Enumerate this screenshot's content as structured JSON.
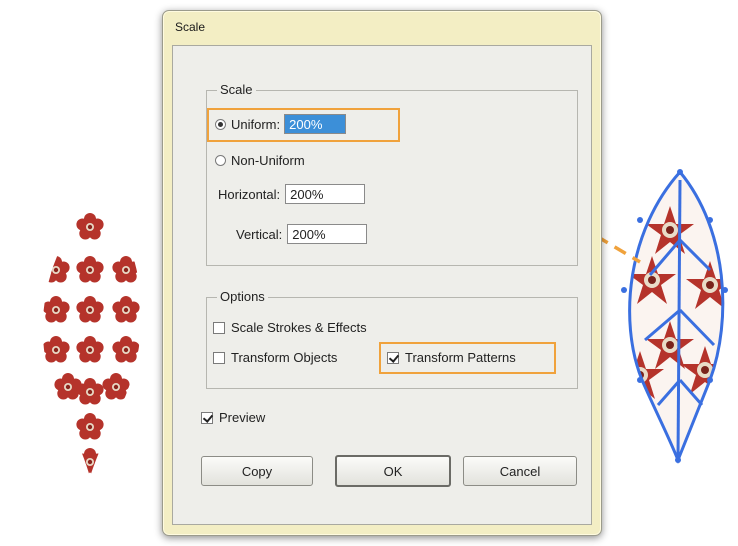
{
  "dialog": {
    "title": "Scale",
    "scale_group": {
      "title": "Scale",
      "uniform_label": "Uniform:",
      "uniform_value": "200%",
      "nonuniform_label": "Non-Uniform",
      "horizontal_label": "Horizontal:",
      "horizontal_value": "200%",
      "vertical_label": "Vertical:",
      "vertical_value": "200%",
      "selected_mode": "uniform"
    },
    "options_group": {
      "title": "Options",
      "scale_strokes_label": "Scale Strokes & Effects",
      "scale_strokes_checked": false,
      "transform_objects_label": "Transform Objects",
      "transform_objects_checked": false,
      "transform_patterns_label": "Transform Patterns",
      "transform_patterns_checked": true
    },
    "preview_label": "Preview",
    "preview_checked": true,
    "buttons": {
      "copy": "Copy",
      "ok": "OK",
      "cancel": "Cancel"
    }
  },
  "colors": {
    "highlight": "#f0a23c",
    "pattern_red": "#b5332b",
    "selection_blue": "#3a6fe0",
    "dialog_frame": "#f3eec4"
  }
}
